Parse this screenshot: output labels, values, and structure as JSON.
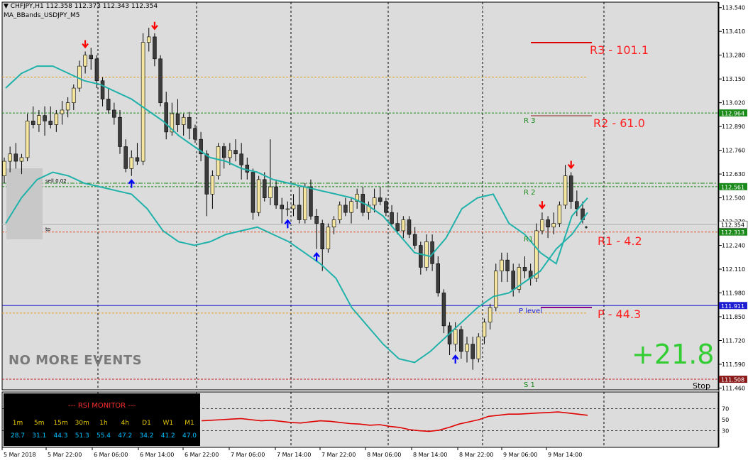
{
  "header": {
    "symbol_line": "CHFJPY,H1  112.358 112.373 112.343 112.354",
    "indicator": "MA_BBands_USDJPY_M5",
    "toggle_icon": "triangle-down-icon"
  },
  "colors": {
    "background": "#ffffff",
    "chart_bg": "#dcdcdc",
    "bull_candle": "#f5e6a0",
    "bear_candle": "#3c3c3c",
    "bands": "#20b2aa",
    "rsi_line": "#e00000",
    "pivot_label": "#ff2020",
    "profit": "#32cd32"
  },
  "overlay": {
    "no_more_events": "NO MORE EVENTS",
    "profit_value": "+21.8",
    "sell_label": "sell 0.02",
    "tp_label": "tp",
    "stop_label": "Stop"
  },
  "levels": {
    "r3_label": "R3 - 101.1",
    "r2_label": "R2 - 61.0",
    "r1_label": "R1 - 4.2",
    "p_label": "P - 44.3",
    "r3_small": "R 3",
    "r2_small": "R 2",
    "r1_small": "R1",
    "p_small": "P level",
    "s1_small": "S 1"
  },
  "price_tags": {
    "r2": "112.964",
    "sell_line": "112.561",
    "current": "112.354",
    "tp_line": "112.313",
    "pivot": "111.911",
    "s1": "111.508"
  },
  "rsi_monitor": {
    "title": "--- RSI MONITOR ---",
    "timeframes": [
      "1m",
      "5m",
      "15m",
      "30m",
      "1h",
      "4h",
      "D1",
      "W1",
      "M1"
    ],
    "values": [
      "28.7",
      "31.1",
      "44.3",
      "51.3",
      "55.4",
      "47.2",
      "34.2",
      "41.2",
      "47.0"
    ]
  },
  "chart_data": {
    "type": "candlestick",
    "y_ticks": [
      "113.540",
      "113.410",
      "113.280",
      "113.150",
      "113.020",
      "112.890",
      "112.760",
      "112.630",
      "112.500",
      "112.370",
      "112.240",
      "112.110",
      "111.980",
      "111.850",
      "111.720",
      "111.590",
      "111.460"
    ],
    "x_ticks": [
      "5 Mar 2018",
      "5 Mar 22:00",
      "6 Mar 06:00",
      "6 Mar 14:00",
      "6 Mar 22:00",
      "7 Mar 06:00",
      "7 Mar 14:00",
      "7 Mar 22:00",
      "8 Mar 06:00",
      "8 Mar 14:00",
      "8 Mar 22:00",
      "9 Mar 06:00",
      "9 Mar 14:00"
    ],
    "ylim": [
      111.45,
      113.57
    ],
    "candles": [
      [
        112.62,
        112.72,
        112.58,
        112.7
      ],
      [
        112.7,
        112.78,
        112.64,
        112.74
      ],
      [
        112.74,
        112.8,
        112.66,
        112.7
      ],
      [
        112.7,
        112.74,
        112.63,
        112.72
      ],
      [
        112.72,
        112.96,
        112.7,
        112.92
      ],
      [
        112.92,
        113.0,
        112.88,
        112.9
      ],
      [
        112.9,
        112.98,
        112.86,
        112.95
      ],
      [
        112.95,
        113.0,
        112.84,
        112.92
      ],
      [
        112.92,
        113.0,
        112.88,
        112.9
      ],
      [
        112.9,
        112.98,
        112.86,
        112.96
      ],
      [
        112.96,
        113.03,
        112.9,
        112.98
      ],
      [
        112.98,
        113.05,
        112.94,
        113.02
      ],
      [
        113.02,
        113.12,
        112.98,
        113.1
      ],
      [
        113.1,
        113.25,
        113.08,
        113.22
      ],
      [
        113.22,
        113.3,
        113.18,
        113.28
      ],
      [
        113.28,
        113.32,
        113.2,
        113.26
      ],
      [
        113.26,
        113.28,
        113.1,
        113.14
      ],
      [
        113.14,
        113.16,
        113.0,
        113.04
      ],
      [
        113.04,
        113.1,
        112.96,
        112.98
      ],
      [
        112.98,
        113.02,
        112.9,
        112.94
      ],
      [
        112.94,
        112.98,
        112.74,
        112.78
      ],
      [
        112.78,
        112.82,
        112.64,
        112.66
      ],
      [
        112.66,
        112.76,
        112.62,
        112.72
      ],
      [
        112.72,
        112.8,
        112.68,
        112.7
      ],
      [
        112.7,
        113.4,
        112.68,
        113.35
      ],
      [
        113.35,
        113.43,
        113.3,
        113.38
      ],
      [
        113.38,
        113.4,
        113.22,
        113.26
      ],
      [
        113.26,
        113.28,
        113.0,
        113.02
      ],
      [
        113.02,
        113.08,
        112.82,
        112.86
      ],
      [
        112.86,
        113.02,
        112.84,
        112.96
      ],
      [
        112.96,
        113.04,
        112.86,
        112.9
      ],
      [
        112.9,
        112.96,
        112.84,
        112.94
      ],
      [
        112.94,
        112.97,
        112.82,
        112.88
      ],
      [
        112.88,
        112.9,
        112.8,
        112.82
      ],
      [
        112.82,
        112.86,
        112.7,
        112.74
      ],
      [
        112.74,
        112.76,
        112.4,
        112.52
      ],
      [
        112.52,
        112.65,
        112.44,
        112.62
      ],
      [
        112.62,
        112.8,
        112.6,
        112.78
      ],
      [
        112.78,
        112.8,
        112.66,
        112.72
      ],
      [
        112.72,
        112.8,
        112.68,
        112.76
      ],
      [
        112.76,
        112.82,
        112.7,
        112.74
      ],
      [
        112.74,
        112.8,
        112.6,
        112.68
      ],
      [
        112.68,
        112.72,
        112.6,
        112.64
      ],
      [
        112.64,
        112.66,
        112.38,
        112.42
      ],
      [
        112.42,
        112.62,
        112.4,
        112.6
      ],
      [
        112.6,
        112.64,
        112.48,
        112.5
      ],
      [
        112.5,
        112.82,
        112.46,
        112.56
      ],
      [
        112.56,
        112.6,
        112.44,
        112.46
      ],
      [
        112.46,
        112.5,
        112.36,
        112.44
      ],
      [
        112.44,
        112.48,
        112.4,
        112.44
      ],
      [
        112.44,
        112.52,
        112.4,
        112.46
      ],
      [
        112.46,
        112.56,
        112.36,
        112.38
      ],
      [
        112.38,
        112.58,
        112.36,
        112.56
      ],
      [
        112.56,
        112.6,
        112.38,
        112.4
      ],
      [
        112.4,
        112.44,
        112.22,
        112.36
      ],
      [
        112.36,
        112.38,
        112.1,
        112.22
      ],
      [
        112.22,
        112.36,
        112.2,
        112.34
      ],
      [
        112.34,
        112.4,
        112.3,
        112.38
      ],
      [
        112.38,
        112.48,
        112.36,
        112.46
      ],
      [
        112.46,
        112.5,
        112.4,
        112.42
      ],
      [
        112.42,
        112.5,
        112.36,
        112.48
      ],
      [
        112.48,
        112.55,
        112.44,
        112.52
      ],
      [
        112.52,
        112.56,
        112.4,
        112.42
      ],
      [
        112.42,
        112.48,
        112.38,
        112.46
      ],
      [
        112.46,
        112.55,
        112.42,
        112.5
      ],
      [
        112.5,
        112.56,
        112.46,
        112.48
      ],
      [
        112.48,
        112.5,
        112.4,
        112.42
      ],
      [
        112.42,
        112.46,
        112.34,
        112.36
      ],
      [
        112.36,
        112.42,
        112.3,
        112.32
      ],
      [
        112.32,
        112.4,
        112.28,
        112.38
      ],
      [
        112.38,
        112.4,
        112.28,
        112.3
      ],
      [
        112.3,
        112.34,
        112.22,
        112.24
      ],
      [
        112.24,
        112.26,
        112.08,
        112.12
      ],
      [
        112.12,
        112.3,
        112.1,
        112.26
      ],
      [
        112.26,
        112.3,
        112.1,
        112.14
      ],
      [
        112.14,
        112.18,
        111.96,
        111.98
      ],
      [
        111.98,
        112.0,
        111.76,
        111.8
      ],
      [
        111.8,
        111.82,
        111.64,
        111.7
      ],
      [
        111.7,
        111.82,
        111.66,
        111.78
      ],
      [
        111.78,
        111.8,
        111.62,
        111.66
      ],
      [
        111.66,
        111.74,
        111.6,
        111.7
      ],
      [
        111.7,
        111.74,
        111.56,
        111.62
      ],
      [
        111.62,
        111.76,
        111.6,
        111.74
      ],
      [
        111.74,
        111.84,
        111.7,
        111.82
      ],
      [
        111.82,
        111.92,
        111.78,
        111.9
      ],
      [
        111.9,
        112.14,
        111.88,
        112.1
      ],
      [
        112.1,
        112.2,
        112.04,
        112.16
      ],
      [
        112.16,
        112.2,
        112.04,
        112.1
      ],
      [
        112.1,
        112.14,
        111.96,
        112.0
      ],
      [
        112.0,
        112.14,
        111.98,
        112.12
      ],
      [
        112.12,
        112.18,
        112.06,
        112.1
      ],
      [
        112.1,
        112.14,
        112.02,
        112.06
      ],
      [
        112.06,
        112.36,
        112.04,
        112.32
      ],
      [
        112.32,
        112.42,
        112.3,
        112.38
      ],
      [
        112.38,
        112.4,
        112.28,
        112.34
      ],
      [
        112.34,
        112.42,
        112.3,
        112.36
      ],
      [
        112.36,
        112.48,
        112.34,
        112.46
      ],
      [
        112.46,
        112.68,
        112.44,
        112.62
      ],
      [
        112.62,
        112.64,
        112.44,
        112.48
      ],
      [
        112.48,
        112.54,
        112.4,
        112.44
      ],
      [
        112.44,
        112.48,
        112.36,
        112.38
      ]
    ],
    "arrows": [
      {
        "type": "sell",
        "candle": 14
      },
      {
        "type": "buy",
        "candle": 22
      },
      {
        "type": "sell",
        "candle": 26
      },
      {
        "type": "buy",
        "candle": 49
      },
      {
        "type": "buy",
        "candle": 54
      },
      {
        "type": "buy",
        "candle": 78
      },
      {
        "type": "sell",
        "candle": 93
      },
      {
        "type": "sell",
        "candle": 98
      }
    ],
    "bollinger_upper": [
      113.1,
      113.18,
      113.22,
      113.22,
      113.18,
      113.14,
      113.12,
      113.08,
      113.04,
      112.98,
      112.92,
      112.84,
      112.78,
      112.72,
      112.7,
      112.66,
      112.64,
      112.6,
      112.58,
      112.56,
      112.54,
      112.52,
      112.5,
      112.46,
      112.4,
      112.3,
      112.2,
      112.18,
      112.28,
      112.44,
      112.5,
      112.52,
      112.36,
      112.3,
      112.2,
      112.14,
      112.4,
      112.5
    ],
    "bollinger_lower": [
      112.36,
      112.5,
      112.6,
      112.64,
      112.62,
      112.58,
      112.56,
      112.54,
      112.52,
      112.44,
      112.32,
      112.26,
      112.24,
      112.26,
      112.3,
      112.32,
      112.34,
      112.3,
      112.26,
      112.2,
      112.14,
      112.06,
      111.9,
      111.8,
      111.7,
      111.62,
      111.6,
      111.66,
      111.74,
      111.82,
      111.9,
      111.96,
      111.98,
      112.04,
      112.1,
      112.22,
      112.3,
      112.42
    ],
    "rsi": {
      "levels": [
        "70",
        "50",
        "30"
      ],
      "values": [
        48,
        49,
        50,
        51,
        52,
        50,
        48,
        49,
        47,
        45,
        44,
        46,
        48,
        47,
        45,
        43,
        42,
        40,
        41,
        38,
        36,
        32,
        30,
        29,
        31,
        36,
        42,
        46,
        50,
        56,
        58,
        60,
        60,
        61,
        62,
        63,
        64,
        62,
        60,
        58
      ]
    }
  }
}
